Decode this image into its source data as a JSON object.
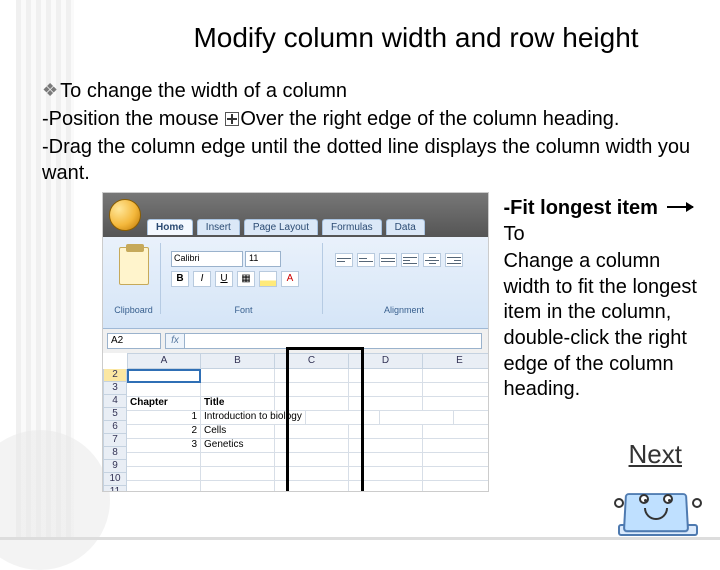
{
  "title": "Modify column width and row height",
  "body": {
    "b1_bullet": "❖",
    "b1": "To change the width of a column",
    "b2a": "-Position the mouse ",
    "b2b": "Over the right edge of the column heading.",
    "b3": "-Drag the column edge until the dotted line displays the column width you want."
  },
  "excel": {
    "tabs": [
      "Home",
      "Insert",
      "Page Layout",
      "Formulas",
      "Data"
    ],
    "panel_labels": {
      "clipboard": "Clipboard",
      "font": "Font",
      "align": "Alignment"
    },
    "font_controls": {
      "name": "Calibri",
      "size": "11",
      "b": "B",
      "i": "I",
      "u": "U"
    },
    "namebox": "A2",
    "columns": [
      "A",
      "B",
      "C",
      "D",
      "E"
    ],
    "rows": [
      "2",
      "3",
      "4",
      "5",
      "6",
      "7",
      "8",
      "9",
      "10",
      "11"
    ],
    "data": {
      "r4": {
        "a": "Chapter",
        "b": "Title"
      },
      "r5": {
        "a": "1",
        "b": "Introduction to biology"
      },
      "r6": {
        "a": "2",
        "b": "Cells"
      },
      "r7": {
        "a": "3",
        "b": "Genetics"
      }
    }
  },
  "side": {
    "fit_label": " -Fit longest item ",
    "to": "To",
    "rest": "Change a column width to fit the longest item in the column, double-click the right edge of the column heading."
  },
  "next": "Next"
}
